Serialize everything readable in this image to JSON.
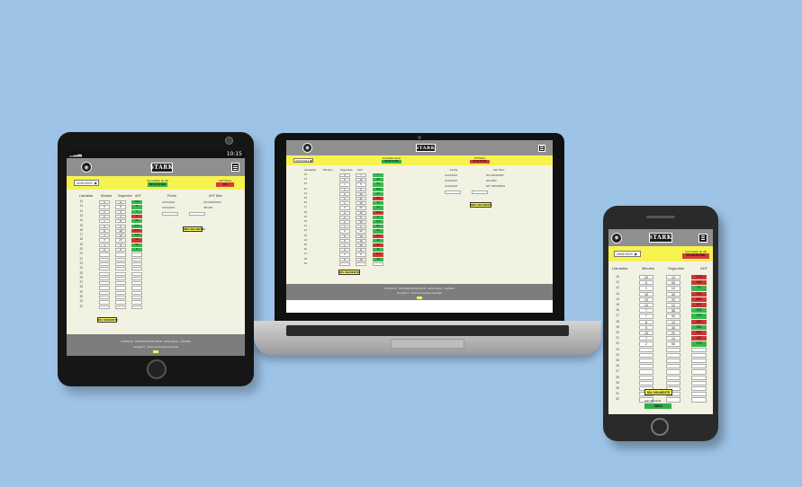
{
  "app": {
    "brand": "STARK",
    "accumulated_label": "Acumulado de día",
    "aht_label": "AHT Diario",
    "columns": [
      "Llamadas",
      "Minutos",
      "Segundos",
      "AHT"
    ],
    "next_day_button": "DÍA SIGUIENTE",
    "next_month_button": "MES SIGUIENTE",
    "history_columns": [
      "Fecha",
      "AHT Mes"
    ],
    "footer_links": "CONTACTO · PROTECCIÓN DE DATOS · AVISO LEGAL · COOKIES",
    "footer_copy": "Copyright © · Todos los derechos reservados"
  },
  "tablet": {
    "status_time": "10:15",
    "date": "31/01/2023",
    "accumulated": "00:05:13:000",
    "aht_daily": "452",
    "rows": [
      {
        "n": "10",
        "m": "4",
        "s": "12",
        "aht": "252",
        "c": "g"
      },
      {
        "n": "11",
        "m": "0",
        "s": "8",
        "aht": "8",
        "c": "g"
      },
      {
        "n": "12",
        "m": "0",
        "s": "4",
        "aht": "4",
        "c": "g"
      },
      {
        "n": "13",
        "m": "0",
        "s": "3",
        "aht": "3",
        "c": "r"
      },
      {
        "n": "14",
        "m": "1",
        "s": "8",
        "aht": "68",
        "c": "g"
      },
      {
        "n": "15",
        "m": "5",
        "s": "0",
        "aht": "300",
        "c": "g"
      },
      {
        "n": "16",
        "m": "8",
        "s": "15",
        "aht": "495",
        "c": "r"
      },
      {
        "n": "17",
        "m": "2",
        "s": "10",
        "aht": "130",
        "c": "g"
      },
      {
        "n": "18",
        "m": "0",
        "s": "20",
        "aht": "20",
        "c": "r"
      },
      {
        "n": "19",
        "m": "1",
        "s": "5",
        "aht": "65",
        "c": "g"
      },
      {
        "n": "20",
        "m": "0",
        "s": "9",
        "aht": "9",
        "c": "g"
      }
    ],
    "empty_rows": [
      "21",
      "22",
      "23",
      "24",
      "25",
      "26",
      "27",
      "28",
      "29",
      "30",
      "31",
      "32"
    ],
    "history": [
      {
        "fecha": "31/01/2023",
        "aht": "202.000000000"
      },
      {
        "fecha": "31/01/2023",
        "aht": "385.000"
      }
    ]
  },
  "laptop": {
    "date": "31/01/2023",
    "accumulated": "00:04:47:000",
    "aht_daily": "00:00:00:000",
    "rows": [
      {
        "n": "10",
        "m": "0",
        "s": "7",
        "aht": "7",
        "c": "g"
      },
      {
        "n": "11",
        "m": "0",
        "s": "12",
        "aht": "12",
        "c": "g"
      },
      {
        "n": "12",
        "m": "1",
        "s": "5",
        "aht": "65",
        "c": "g"
      },
      {
        "n": "13",
        "m": "2",
        "s": "0",
        "aht": "120",
        "c": "g"
      },
      {
        "n": "14",
        "m": "0",
        "s": "30",
        "aht": "30",
        "c": "g"
      },
      {
        "n": "15",
        "m": "4",
        "s": "41",
        "aht": "281",
        "c": "r"
      },
      {
        "n": "16",
        "m": "1",
        "s": "10",
        "aht": "70",
        "c": "g"
      },
      {
        "n": "17",
        "m": "0",
        "s": "22",
        "aht": "22",
        "c": "g"
      },
      {
        "n": "18",
        "m": "3",
        "s": "15",
        "aht": "195",
        "c": "r"
      },
      {
        "n": "19",
        "m": "0",
        "s": "9",
        "aht": "9",
        "c": "g"
      },
      {
        "n": "20",
        "m": "2",
        "s": "30",
        "aht": "150",
        "c": "g"
      },
      {
        "n": "21",
        "m": "1",
        "s": "2",
        "aht": "62",
        "c": "g"
      },
      {
        "n": "22",
        "m": "0",
        "s": "40",
        "aht": "40",
        "c": "g"
      },
      {
        "n": "23",
        "m": "5",
        "s": "10",
        "aht": "310",
        "c": "r"
      },
      {
        "n": "24",
        "m": "0",
        "s": "16",
        "aht": "16",
        "c": "g"
      },
      {
        "n": "25",
        "m": "1",
        "s": "45",
        "aht": "105",
        "c": "r"
      },
      {
        "n": "26",
        "m": "0",
        "s": "11",
        "aht": "11",
        "c": "g"
      },
      {
        "n": "27",
        "m": "2",
        "s": "5",
        "aht": "125",
        "c": "r"
      },
      {
        "n": "28",
        "m": "0",
        "s": "19",
        "aht": "19",
        "c": "g"
      }
    ],
    "empty_rows": [
      "29"
    ],
    "history": [
      {
        "fecha": "31/01/2023",
        "aht": "202.000000000"
      },
      {
        "fecha": "31/01/2023",
        "aht": "300.0000"
      },
      {
        "fecha": "31/01/2023",
        "aht": "287.7051282051"
      }
    ]
  },
  "phone": {
    "date": "26/01/2023",
    "accumulated": "00:08:02:000",
    "aht_monthly_label": "AHT Mensual",
    "aht_monthly": "286.5",
    "rows": [
      {
        "n": "10",
        "m": "20",
        "s": "10",
        "aht": "1210",
        "c": "r"
      },
      {
        "n": "11",
        "m": "6",
        "s": "55",
        "aht": "415",
        "c": "r"
      },
      {
        "n": "12",
        "m": "1",
        "s": "10",
        "aht": "70",
        "c": "g"
      },
      {
        "n": "13",
        "m": "15",
        "s": "30",
        "aht": "930",
        "c": "r"
      },
      {
        "n": "14",
        "m": "14",
        "s": "20",
        "aht": "860",
        "c": "r"
      },
      {
        "n": "15",
        "m": "10",
        "s": "12",
        "aht": "612",
        "c": "r"
      },
      {
        "n": "16",
        "m": "7",
        "s": "58",
        "aht": "478",
        "c": "g"
      },
      {
        "n": "17",
        "m": "7",
        "s": "55",
        "aht": "475",
        "c": "g"
      },
      {
        "n": "18",
        "m": "8",
        "s": "10",
        "aht": "490",
        "c": "r"
      },
      {
        "n": "19",
        "m": "5",
        "s": "30",
        "aht": "330",
        "c": "g"
      },
      {
        "n": "20",
        "m": "15",
        "s": "20",
        "aht": "920",
        "c": "r"
      },
      {
        "n": "21",
        "m": "7",
        "s": "10",
        "aht": "430",
        "c": "r"
      },
      {
        "n": "22",
        "m": "2",
        "s": "56",
        "aht": "176",
        "c": "g"
      }
    ],
    "empty_rows": [
      "23",
      "24",
      "25",
      "26",
      "27",
      "28",
      "29",
      "30",
      "31",
      "32"
    ]
  }
}
